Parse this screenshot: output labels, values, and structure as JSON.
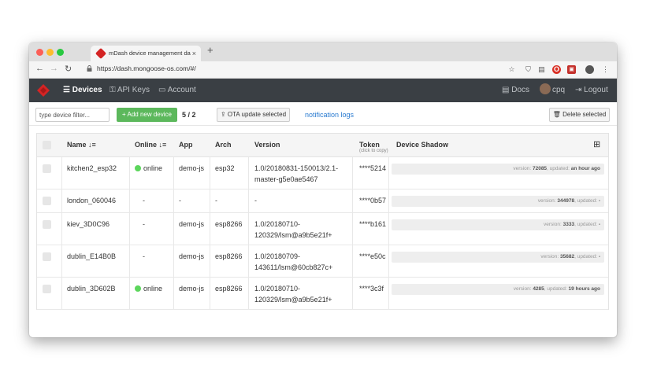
{
  "browser": {
    "tab_title": "mDash device management da",
    "tab_close": "×",
    "new_tab": "+",
    "url": "https://dash.mongoose-os.com/#/"
  },
  "nav": {
    "devices": "Devices",
    "api_keys": "API Keys",
    "account": "Account",
    "docs": "Docs",
    "user": "cpq",
    "logout": "Logout"
  },
  "toolbar": {
    "filter_placeholder": "type device filter...",
    "add_device": "+ Add new device",
    "count": "5 / 2",
    "ota": "OTA update selected",
    "notification_logs": "notification logs",
    "delete_selected": "Delete selected"
  },
  "table": {
    "headers": {
      "name": "Name",
      "online": "Online",
      "app": "App",
      "arch": "Arch",
      "version": "Version",
      "token": "Token",
      "token_hint": "(click to copy)",
      "shadow": "Device Shadow"
    },
    "shadow_labels": {
      "version": "version:",
      "updated": "updated:"
    },
    "rows": [
      {
        "name": "kitchen2_esp32",
        "online": "online",
        "app": "demo-js",
        "arch": "esp32",
        "version_1": "1.0/20180831-150013/2.1-",
        "version_2": "master-g5e0ae5467",
        "token": "****5214",
        "shadow_version": "72085",
        "shadow_updated": "an hour ago"
      },
      {
        "name": "london_060046",
        "online": "-",
        "app": "-",
        "arch": "-",
        "version_1": "-",
        "version_2": "",
        "token": "****0b57",
        "shadow_version": "344978",
        "shadow_updated": "-"
      },
      {
        "name": "kiev_3D0C96",
        "online": "-",
        "app": "demo-js",
        "arch": "esp8266",
        "version_1": "1.0/20180710-",
        "version_2": "120329/lsm@a9b5e21f+",
        "token": "****b161",
        "shadow_version": "3333",
        "shadow_updated": "-"
      },
      {
        "name": "dublin_E14B0B",
        "online": "-",
        "app": "demo-js",
        "arch": "esp8266",
        "version_1": "1.0/20180709-",
        "version_2": "143611/lsm@60cb827c+",
        "token": "****e50c",
        "shadow_version": "35682",
        "shadow_updated": "-"
      },
      {
        "name": "dublin_3D602B",
        "online": "online",
        "app": "demo-js",
        "arch": "esp8266",
        "version_1": "1.0/20180710-",
        "version_2": "120329/lsm@a9b5e21f+",
        "token": "****3c3f",
        "shadow_version": "4285",
        "shadow_updated": "19 hours ago"
      }
    ]
  },
  "colors": {
    "navbar": "#3a3f44",
    "accent_green": "#5cb85c",
    "link": "#2a7bd0",
    "online_dot": "#5cd65c"
  }
}
